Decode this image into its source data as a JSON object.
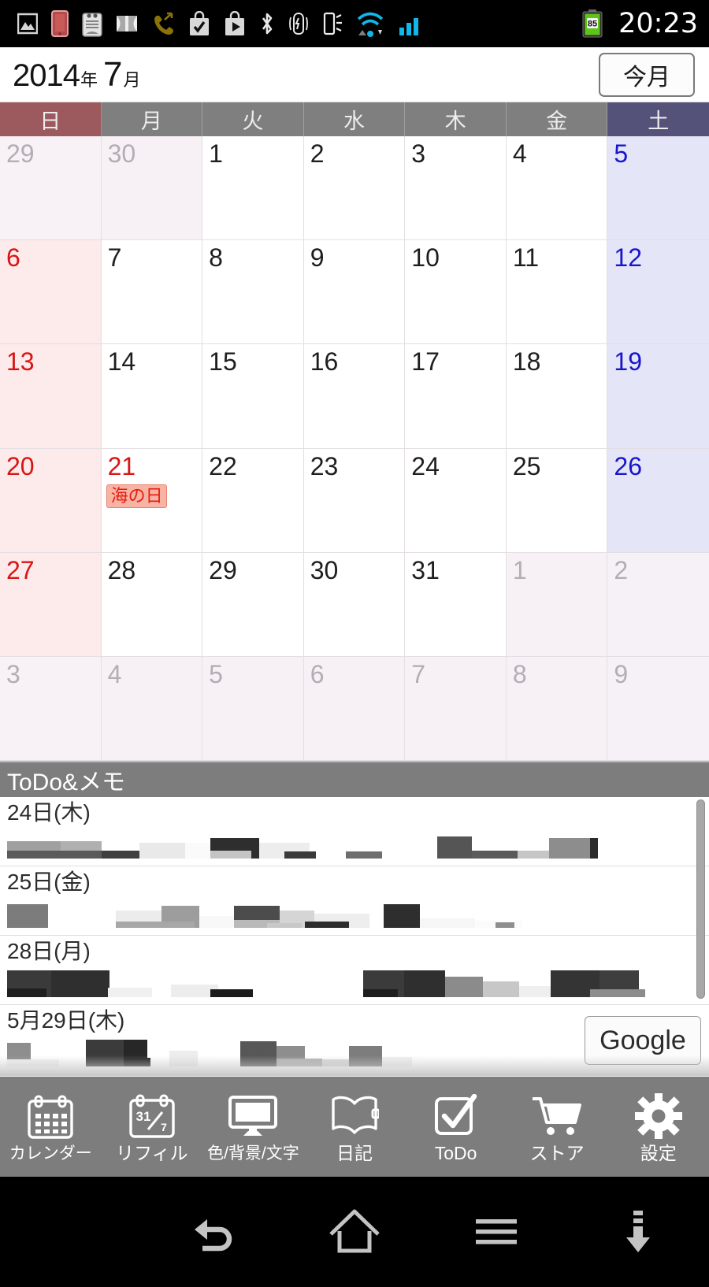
{
  "statusbar": {
    "time": "20:23",
    "battery_percent": "85",
    "icons": [
      "gallery-image-icon",
      "phone-red-icon",
      "clipboard-android-icon",
      "panorama-icon",
      "missed-call-icon",
      "play-store-check-icon",
      "play-store-video-icon",
      "bluetooth-icon",
      "vibrate-alert-icon",
      "flashlight-icon",
      "wifi-icon",
      "signal-bars-icon",
      "battery-icon"
    ]
  },
  "header": {
    "year": "2014",
    "year_unit": "年",
    "month": "7",
    "month_unit": "月",
    "this_month_button": "今月"
  },
  "weekdays": [
    {
      "label": "日",
      "kind": "sun"
    },
    {
      "label": "月",
      "kind": "wd"
    },
    {
      "label": "火",
      "kind": "wd"
    },
    {
      "label": "水",
      "kind": "wd"
    },
    {
      "label": "木",
      "kind": "wd"
    },
    {
      "label": "金",
      "kind": "wd"
    },
    {
      "label": "土",
      "kind": "sat"
    }
  ],
  "calendar": {
    "colors": {
      "sunday_header": "#9c5a5e",
      "saturday_header": "#555279",
      "weekday_header": "#7f7f7f",
      "sunday_cell": "#fdeaea",
      "saturday_cell": "#e4e6f7",
      "outside_cell": "#f7f1f5",
      "sunday_text": "#d81515",
      "saturday_text": "#1915cc",
      "holiday_badge_bg": "#f7b3a4",
      "holiday_badge_text": "#e81b0d"
    },
    "days": [
      {
        "n": "29",
        "col": 0,
        "out": true
      },
      {
        "n": "30",
        "col": 1,
        "out": true
      },
      {
        "n": "1",
        "col": 2,
        "out": false
      },
      {
        "n": "2",
        "col": 3,
        "out": false
      },
      {
        "n": "3",
        "col": 4,
        "out": false
      },
      {
        "n": "4",
        "col": 5,
        "out": false
      },
      {
        "n": "5",
        "col": 6,
        "out": false
      },
      {
        "n": "6",
        "col": 0,
        "out": false
      },
      {
        "n": "7",
        "col": 1,
        "out": false
      },
      {
        "n": "8",
        "col": 2,
        "out": false
      },
      {
        "n": "9",
        "col": 3,
        "out": false
      },
      {
        "n": "10",
        "col": 4,
        "out": false
      },
      {
        "n": "11",
        "col": 5,
        "out": false
      },
      {
        "n": "12",
        "col": 6,
        "out": false
      },
      {
        "n": "13",
        "col": 0,
        "out": false
      },
      {
        "n": "14",
        "col": 1,
        "out": false
      },
      {
        "n": "15",
        "col": 2,
        "out": false
      },
      {
        "n": "16",
        "col": 3,
        "out": false
      },
      {
        "n": "17",
        "col": 4,
        "out": false
      },
      {
        "n": "18",
        "col": 5,
        "out": false
      },
      {
        "n": "19",
        "col": 6,
        "out": false
      },
      {
        "n": "20",
        "col": 0,
        "out": false
      },
      {
        "n": "21",
        "col": 1,
        "out": false,
        "holiday": "海の日",
        "holiday_color": true
      },
      {
        "n": "22",
        "col": 2,
        "out": false
      },
      {
        "n": "23",
        "col": 3,
        "out": false
      },
      {
        "n": "24",
        "col": 4,
        "out": false
      },
      {
        "n": "25",
        "col": 5,
        "out": false
      },
      {
        "n": "26",
        "col": 6,
        "out": false
      },
      {
        "n": "27",
        "col": 0,
        "out": false
      },
      {
        "n": "28",
        "col": 1,
        "out": false
      },
      {
        "n": "29",
        "col": 2,
        "out": false
      },
      {
        "n": "30",
        "col": 3,
        "out": false
      },
      {
        "n": "31",
        "col": 4,
        "out": false
      },
      {
        "n": "1",
        "col": 5,
        "out": true
      },
      {
        "n": "2",
        "col": 6,
        "out": true
      },
      {
        "n": "3",
        "col": 0,
        "out": true
      },
      {
        "n": "4",
        "col": 1,
        "out": true
      },
      {
        "n": "5",
        "col": 2,
        "out": true
      },
      {
        "n": "6",
        "col": 3,
        "out": true
      },
      {
        "n": "7",
        "col": 4,
        "out": true
      },
      {
        "n": "8",
        "col": 5,
        "out": true
      },
      {
        "n": "9",
        "col": 6,
        "out": true
      }
    ]
  },
  "todo": {
    "panel_title": "ToDo&メモ",
    "google_button": "Google",
    "entries": [
      {
        "date": "24日(木)",
        "content": "redacted"
      },
      {
        "date": "25日(金)",
        "content": "redacted"
      },
      {
        "date": "28日(月)",
        "content": "redacted"
      },
      {
        "date": "5月29日(木)",
        "content": "redacted"
      }
    ]
  },
  "toolbar": {
    "items": [
      {
        "label": "カレンダー",
        "icon": "calendar-icon",
        "small": true
      },
      {
        "label": "リフィル",
        "icon": "refill-calendar-icon",
        "small": false
      },
      {
        "label": "色/背景/文字",
        "icon": "monitor-icon",
        "small": true
      },
      {
        "label": "日記",
        "icon": "book-icon",
        "small": false
      },
      {
        "label": "ToDo",
        "icon": "checkbox-icon",
        "small": false
      },
      {
        "label": "ストア",
        "icon": "cart-icon",
        "small": false
      },
      {
        "label": "設定",
        "icon": "gear-icon",
        "small": false
      }
    ],
    "refill_icon_text": "31/7"
  },
  "navbar": {
    "buttons": [
      "back-icon",
      "home-icon",
      "menu-icon",
      "download-arrow-icon"
    ]
  }
}
